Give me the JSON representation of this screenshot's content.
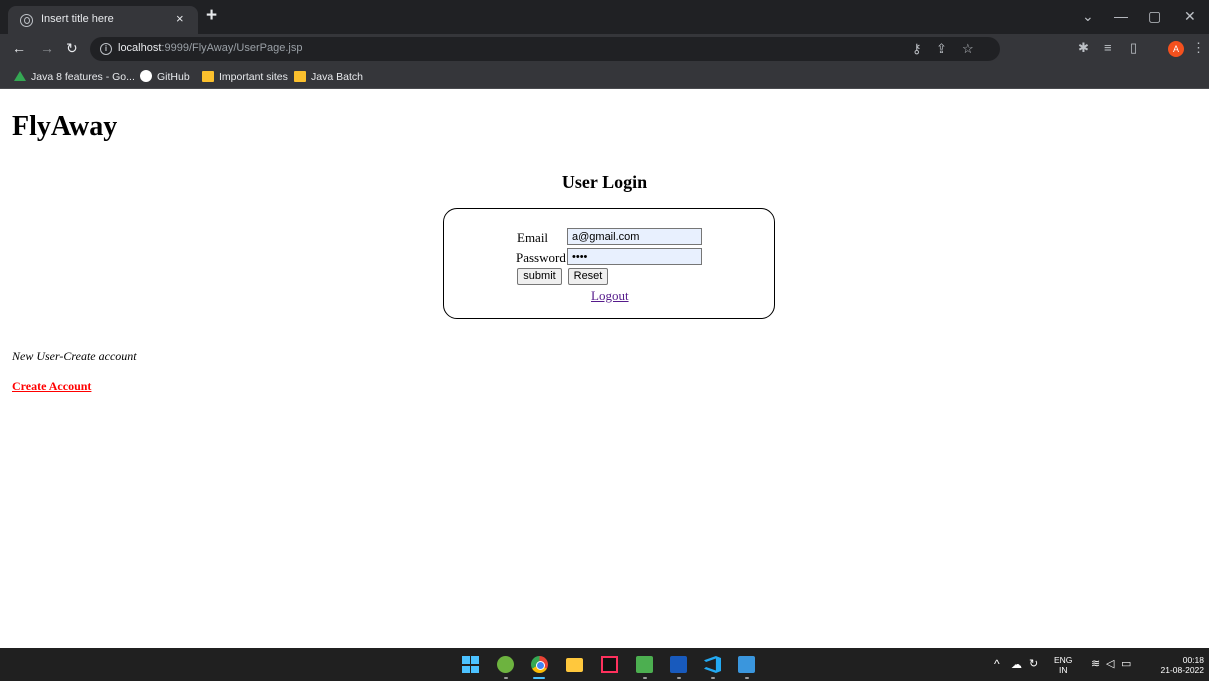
{
  "browser": {
    "tab_title": "Insert title here",
    "tab_close": "×",
    "new_tab": "+",
    "url_host": "localhost",
    "url_rest": ":9999/FlyAway/UserPage.jsp",
    "icons": {
      "back": "arrow-left-icon",
      "forward": "arrow-right-icon",
      "reload": "reload-icon",
      "site_info": "info-icon",
      "key": "key-icon",
      "share": "share-icon",
      "bookmark_star": "star-icon",
      "extensions": "puzzle-icon",
      "reading_list": "reading-list-icon",
      "side_panel": "side-panel-icon",
      "menu": "kebab-menu-icon"
    },
    "avatar_letter": "A",
    "window_controls": [
      "⌄",
      "—",
      "▢",
      "✕"
    ]
  },
  "bookmarks": [
    {
      "label": "Java 8 features - Go...",
      "icon": "google-drive-icon"
    },
    {
      "label": "GitHub",
      "icon": "github-icon"
    },
    {
      "label": "Important sites",
      "icon": "folder-icon"
    },
    {
      "label": "Java Batch",
      "icon": "folder-icon"
    }
  ],
  "page": {
    "brand": "FlyAway",
    "login_title": "User Login",
    "form": {
      "email_label": "Email",
      "email_value": "a@gmail.com",
      "password_label": "Password",
      "password_value": "••••",
      "submit_label": "submit",
      "reset_label": "Reset",
      "logout_label": "Logout"
    },
    "new_user_text": "New User-Create account",
    "create_account_label": "Create Account"
  },
  "taskbar": {
    "apps": [
      "windows-start-icon",
      "spring-tools-icon",
      "chrome-icon",
      "file-explorer-icon",
      "intellij-icon",
      "notepad-icon",
      "word-icon",
      "vscode-icon",
      "app-icon"
    ],
    "tray": {
      "language": "ENG",
      "region": "IN",
      "time": "00:18",
      "date": "21-08-2022"
    }
  },
  "colors": {
    "tabstrip": "#202124",
    "toolbar": "#35363a",
    "link_red": "#ff0000",
    "link_visited": "#551a8b",
    "taskbar": "#202020"
  }
}
